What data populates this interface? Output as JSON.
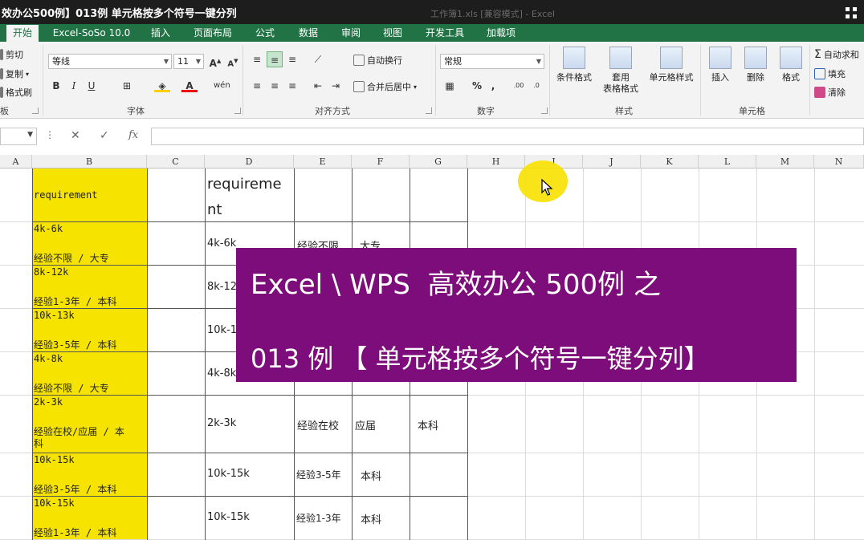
{
  "title_bar": {
    "video_title": "效办公500例】013例 单元格按多个符号一键分列",
    "window_title": "工作簿1.xls [兼容模式] - Excel"
  },
  "tabs": [
    {
      "label": "开始",
      "active": true
    },
    {
      "label": "Excel-SoSo 10.0",
      "active": false
    },
    {
      "label": "插入",
      "active": false
    },
    {
      "label": "页面布局",
      "active": false
    },
    {
      "label": "公式",
      "active": false
    },
    {
      "label": "数据",
      "active": false
    },
    {
      "label": "审阅",
      "active": false
    },
    {
      "label": "视图",
      "active": false
    },
    {
      "label": "开发工具",
      "active": false
    },
    {
      "label": "加载项",
      "active": false
    }
  ],
  "ribbon": {
    "clipboard": {
      "cut": "剪切",
      "copy": "复制",
      "format_painter": "格式刷",
      "group": "板"
    },
    "font": {
      "name": "等线",
      "size": "11",
      "group": "字体"
    },
    "alignment": {
      "wrap_text": "自动换行",
      "merge_center": "合并后居中",
      "group": "对齐方式"
    },
    "number": {
      "format": "常规",
      "percent": "%",
      "comma": ",",
      "group": "数字"
    },
    "styles": {
      "conditional": "条件格式",
      "table_line1": "套用",
      "table_line2": "表格格式",
      "cell_styles": "单元格样式",
      "group": "样式"
    },
    "cells": {
      "insert": "插入",
      "delete": "删除",
      "format": "格式",
      "group": "单元格"
    },
    "editing": {
      "autosum": "自动求和",
      "fill": "填充",
      "clear": "清除"
    }
  },
  "formula_bar": {
    "fx": "fx"
  },
  "columns": [
    "A",
    "B",
    "C",
    "D",
    "E",
    "F",
    "G",
    "H",
    "I",
    "J",
    "K",
    "L",
    "M",
    "N"
  ],
  "sheet": {
    "header_b": "requirement",
    "header_d_line1": "requireme",
    "header_d_line2": "nt",
    "rows": [
      {
        "b1": "4k-6k",
        "b2": "经验不限 / 大专",
        "d": "4k-6k",
        "e": "经验不限",
        "f": "大专",
        "g": ""
      },
      {
        "b1": "8k-12k",
        "b2": "经验1-3年 / 本科",
        "d": "8k-12",
        "e": "",
        "f": "",
        "g": ""
      },
      {
        "b1": "10k-13k",
        "b2": "经验3-5年 / 本科",
        "d": "10k-1",
        "e": "",
        "f": "",
        "g": ""
      },
      {
        "b1": "4k-8k",
        "b2": "经验不限 / 大专",
        "d": "4k-8k",
        "e": "",
        "f": "",
        "g": ""
      },
      {
        "b1": "2k-3k",
        "b2": "经验在校/应届 / 本",
        "b3": "科",
        "d": "2k-3k",
        "e": "经验在校",
        "f": "应届",
        "g": "本科"
      },
      {
        "b1": "10k-15k",
        "b2": "经验3-5年 / 本科",
        "d": "10k-15k",
        "e": "经验3-5年",
        "f": "本科",
        "g": ""
      },
      {
        "b1": "10k-15k",
        "b2": "经验1-3年 / 本科",
        "d": "10k-15k",
        "e": "经验1-3年",
        "f": "本科",
        "g": ""
      }
    ]
  },
  "overlay": {
    "line1": "Excel \\ WPS  高效办公 500例 之",
    "line2": "013 例 【 单元格按多个符号一键分列】"
  },
  "colors": {
    "ribbon_green": "#217346",
    "highlight_yellow": "#f6e400",
    "overlay_purple": "#7d0d7a"
  }
}
